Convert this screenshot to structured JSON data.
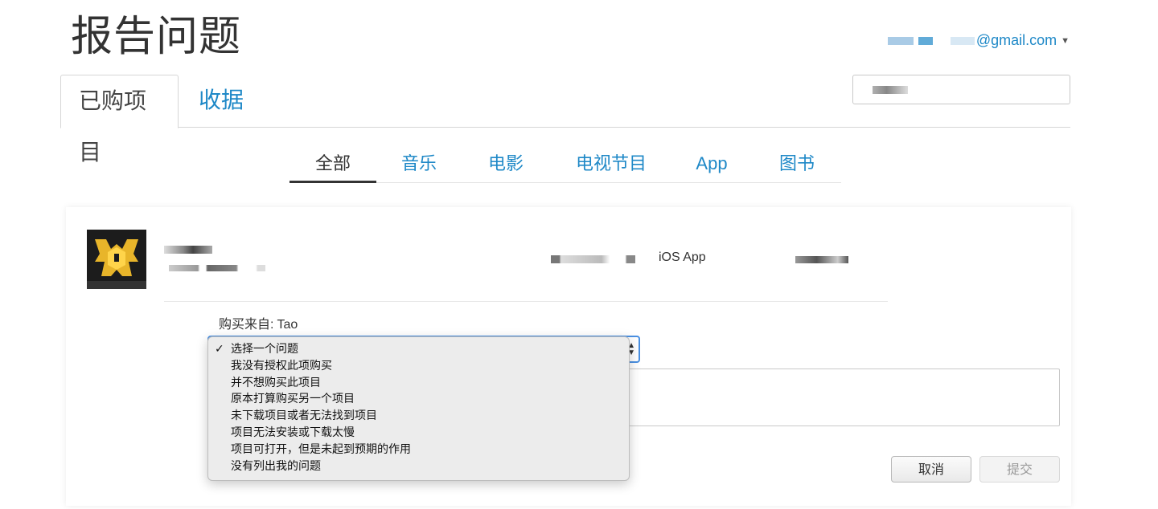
{
  "header": {
    "title": "报告问题",
    "account_email": "@gmail.com"
  },
  "main_tabs": [
    {
      "label": "已购项目",
      "active": true
    },
    {
      "label": "收据",
      "active": false
    }
  ],
  "filter_tabs": [
    {
      "label": "全部",
      "active": true
    },
    {
      "label": "音乐",
      "active": false
    },
    {
      "label": "电影",
      "active": false
    },
    {
      "label": "电视节目",
      "active": false
    },
    {
      "label": "App",
      "active": false
    },
    {
      "label": "图书",
      "active": false
    }
  ],
  "item": {
    "type": "iOS App",
    "purchased_from_label": "购买来自:",
    "purchased_from_value": "Tao"
  },
  "problem_select": {
    "selected": "选择一个问题",
    "options": [
      "选择一个问题",
      "我没有授权此项购买",
      "并不想购买此项目",
      "原本打算购买另一个项目",
      "未下载项目或者无法找到项目",
      "项目无法安装或下载太慢",
      "项目可打开，但是未起到预期的作用",
      "没有列出我的问题"
    ]
  },
  "buttons": {
    "cancel": "取消",
    "submit": "提交"
  },
  "colors": {
    "link": "#1e88c7",
    "focus": "#4a90e2"
  }
}
